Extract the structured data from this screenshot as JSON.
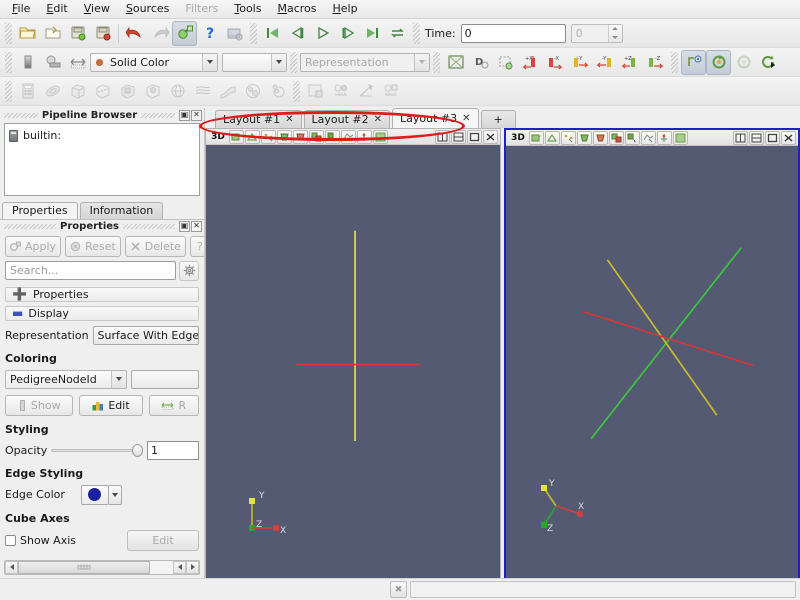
{
  "app": {
    "name": "ParaView"
  },
  "menubar": {
    "items": [
      {
        "label": "File",
        "enabled": true
      },
      {
        "label": "Edit",
        "enabled": true
      },
      {
        "label": "View",
        "enabled": true
      },
      {
        "label": "Sources",
        "enabled": true
      },
      {
        "label": "Filters",
        "enabled": false
      },
      {
        "label": "Tools",
        "enabled": true
      },
      {
        "label": "Macros",
        "enabled": true
      },
      {
        "label": "Help",
        "enabled": true
      }
    ]
  },
  "toolbar_main": {
    "buttons": [
      {
        "name": "open-file-icon",
        "enabled": true
      },
      {
        "name": "recent-files-icon",
        "enabled": true
      },
      {
        "name": "save-state-icon",
        "enabled": true
      },
      {
        "name": "load-state-icon",
        "enabled": true
      },
      {
        "name": "undo-icon",
        "enabled": true
      },
      {
        "name": "redo-icon",
        "enabled": false
      },
      {
        "name": "camera-link-icon",
        "enabled": true,
        "checked": true
      },
      {
        "name": "help-question-icon",
        "enabled": true
      },
      {
        "name": "save-screenshot-icon",
        "enabled": false
      }
    ],
    "vcr": [
      {
        "name": "first-frame-icon"
      },
      {
        "name": "previous-frame-icon"
      },
      {
        "name": "play-icon"
      },
      {
        "name": "next-frame-icon"
      },
      {
        "name": "last-frame-icon"
      },
      {
        "name": "loop-icon"
      }
    ],
    "time_label": "Time:",
    "time_value": "0",
    "frame_value": "0"
  },
  "toolbar_repr": {
    "buttons": [
      {
        "name": "color-legend-icon"
      },
      {
        "name": "edit-color-map-icon"
      },
      {
        "name": "rescale-range-icon"
      }
    ],
    "color_by": {
      "value": "Solid Color",
      "icon": "solid-color-swatch-icon"
    },
    "component": {
      "value": ""
    },
    "representation": {
      "placeholder": "Representation",
      "value": ""
    },
    "camera_buttons": [
      {
        "name": "reset-camera-icon"
      },
      {
        "name": "zoom-to-data-icon"
      },
      {
        "name": "zoom-to-box-icon"
      },
      {
        "name": "set-view-minus-x-icon",
        "label": "+X"
      },
      {
        "name": "set-view-plus-x-icon",
        "label": "-X"
      },
      {
        "name": "set-view-plus-y-icon",
        "label": "+Y"
      },
      {
        "name": "set-view-minus-y-icon",
        "label": "-Y"
      },
      {
        "name": "set-view-plus-z-icon",
        "label": "+Z"
      },
      {
        "name": "set-view-minus-z-icon",
        "label": "-Z"
      }
    ],
    "rotate_buttons": [
      {
        "name": "center-axes-visibility-icon",
        "checked": true
      },
      {
        "name": "rotate-90-ccw-icon",
        "checked": true
      },
      {
        "name": "rotate-90-cw-icon",
        "enabled": false
      },
      {
        "name": "reset-rotation-icon",
        "enabled": true
      }
    ]
  },
  "toolbar_sources": {
    "buttons": [
      {
        "name": "calculator-icon"
      },
      {
        "name": "contour-icon"
      },
      {
        "name": "clip-icon"
      },
      {
        "name": "slice-icon"
      },
      {
        "name": "threshold-icon"
      },
      {
        "name": "extract-subset-icon"
      },
      {
        "name": "glyph-icon"
      },
      {
        "name": "stream-tracer-icon"
      },
      {
        "name": "warp-icon"
      },
      {
        "name": "group-datasets-icon"
      },
      {
        "name": "extract-level-icon"
      },
      {
        "name": "last-accepted-icon"
      },
      {
        "name": "plot-over-time-icon"
      },
      {
        "name": "plot-selection-icon"
      },
      {
        "name": "plot-data-icon"
      }
    ]
  },
  "pipeline_browser": {
    "title": "Pipeline Browser",
    "float_button": "float-icon",
    "close_button": "close-icon",
    "items": [
      {
        "label": "builtin:",
        "icon": "server-icon"
      }
    ]
  },
  "panel_tabs": [
    {
      "label": "Properties",
      "active": true
    },
    {
      "label": "Information",
      "active": false
    }
  ],
  "properties_panel": {
    "title": "Properties",
    "float_button": "float-icon",
    "close_button": "close-icon",
    "actions": [
      {
        "label": "Apply",
        "name": "apply-button",
        "enabled": false,
        "icon": "apply-icon"
      },
      {
        "label": "Reset",
        "name": "reset-button",
        "enabled": false,
        "icon": "reset-icon"
      },
      {
        "label": "Delete",
        "name": "delete-button",
        "enabled": false,
        "icon": "delete-icon"
      },
      {
        "label": "?",
        "name": "help-button",
        "enabled": false,
        "icon": "question-icon"
      }
    ],
    "search_placeholder": "Search...",
    "gear_button": "gear-icon",
    "sections": [
      {
        "label": "Properties",
        "icon": "plus-icon"
      },
      {
        "label": "Display",
        "icon": "minus-icon"
      }
    ],
    "representation": {
      "label": "Representation",
      "value": "Surface With Edges"
    },
    "coloring": {
      "group_label": "Coloring",
      "array": "PedigreeNodeId",
      "component": "",
      "buttons": [
        {
          "label": "Show",
          "name": "show-scalar-bar-button",
          "enabled": false,
          "icon": "scalar-bar-icon"
        },
        {
          "label": "Edit",
          "name": "edit-color-map-button",
          "enabled": true,
          "icon": "edit-colormap-icon"
        },
        {
          "label": "R",
          "name": "rescale-button",
          "enabled": false,
          "icon": "rescale-icon"
        }
      ]
    },
    "styling": {
      "group_label": "Styling",
      "opacity_label": "Opacity",
      "opacity_value": "1",
      "opacity_percent": 100
    },
    "edge_styling": {
      "group_label": "Edge Styling",
      "edge_color_label": "Edge Color",
      "edge_color_hex": "#1b21a0"
    },
    "cube_axes": {
      "group_label": "Cube Axes",
      "show_axis_label": "Show Axis",
      "show_axis_checked": false,
      "edit_label": "Edit",
      "edit_enabled": false
    }
  },
  "layout_tabs": {
    "tabs": [
      {
        "label": "Layout #1",
        "close": "✕",
        "active": false
      },
      {
        "label": "Layout #2",
        "close": "✕",
        "active": false
      },
      {
        "label": "Layout #3",
        "close": "✕",
        "active": true
      }
    ],
    "add_label": "+"
  },
  "annotation": {
    "shape": "ellipse",
    "color": "#e01b1b",
    "target": "layout-tabs"
  },
  "views": [
    {
      "name": "render-view-left",
      "type_label": "3D",
      "active": false,
      "background_hex": "#535a72",
      "toolbar_buttons": [
        "camera-undo-icon",
        "select-surface-cells-icon",
        "select-surface-points-icon",
        "select-frustum-cells-icon",
        "select-frustum-points-icon",
        "select-blocks-icon",
        "interactive-select-icon",
        "select-polygon-icon",
        "hover-points-icon",
        "zoom-to-box-icon"
      ],
      "window_buttons": [
        "split-horizontal-icon",
        "split-vertical-icon",
        "maximize-icon",
        "close-icon"
      ],
      "geometry": [
        {
          "name": "vertical-line",
          "color": "#e8e832"
        },
        {
          "name": "horizontal-line",
          "color": "#d83636"
        }
      ],
      "axes_widget": {
        "x_label": "X",
        "y_label": "Y",
        "z_label": "Z"
      }
    },
    {
      "name": "render-view-right",
      "type_label": "3D",
      "active": true,
      "background_hex": "#535a72",
      "toolbar_buttons": [
        "camera-undo-icon",
        "select-surface-cells-icon",
        "select-surface-points-icon",
        "select-frustum-cells-icon",
        "select-frustum-points-icon",
        "select-blocks-icon",
        "interactive-select-icon",
        "select-polygon-icon",
        "hover-points-icon",
        "zoom-to-box-icon"
      ],
      "window_buttons": [
        "split-horizontal-icon",
        "split-vertical-icon",
        "maximize-icon",
        "close-icon"
      ],
      "geometry": [
        {
          "name": "green-diagonal-line",
          "color": "#3fc23f"
        },
        {
          "name": "yellow-diagonal-line",
          "color": "#c8b830"
        },
        {
          "name": "red-line",
          "color": "#d83636"
        }
      ],
      "axes_widget": {
        "x_label": "X",
        "y_label": "Y",
        "z_label": "Z"
      }
    }
  ],
  "statusbar": {
    "cancel_button": "cancel-icon",
    "progress_value": ""
  }
}
